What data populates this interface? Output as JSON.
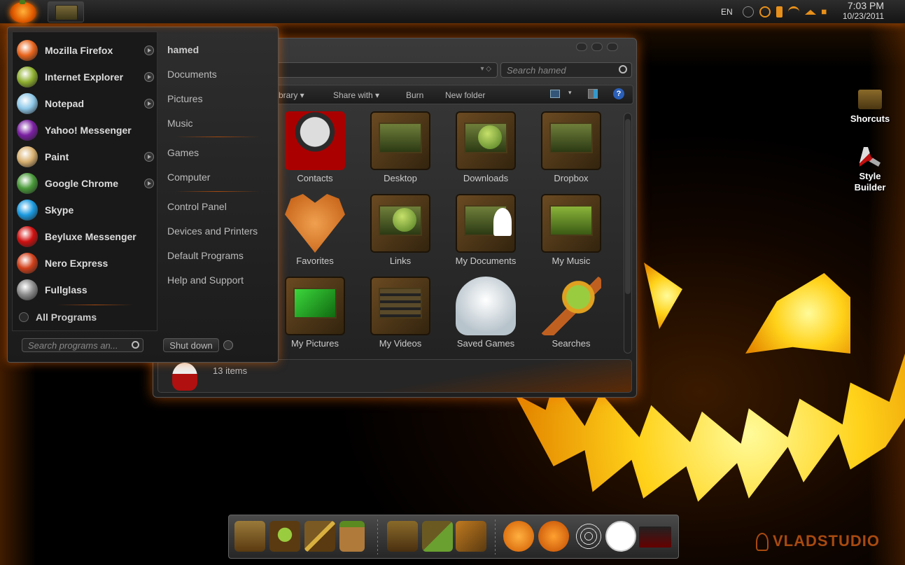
{
  "taskbar": {
    "language": "EN",
    "time": "7:03 PM",
    "date": "10/23/2011"
  },
  "start_menu": {
    "programs": [
      {
        "label": "Mozilla Firefox",
        "icon": "firefox-icon",
        "color": "#e8641c",
        "has_arrow": true
      },
      {
        "label": "Internet Explorer",
        "icon": "internet-explorer-icon",
        "color": "#8fb030",
        "has_arrow": true
      },
      {
        "label": "Notepad",
        "icon": "notepad-icon",
        "color": "#8ec8e8",
        "has_arrow": true
      },
      {
        "label": "Yahoo! Messenger",
        "icon": "yahoo-messenger-icon",
        "color": "#7a1fa2",
        "has_arrow": false
      },
      {
        "label": "Paint",
        "icon": "paint-icon",
        "color": "#d8b070",
        "has_arrow": true
      },
      {
        "label": "Google Chrome",
        "icon": "chrome-icon",
        "color": "#4a9a3a",
        "has_arrow": true
      },
      {
        "label": "Skype",
        "icon": "skype-icon",
        "color": "#1a9ae0",
        "has_arrow": false
      },
      {
        "label": "Beyluxe Messenger",
        "icon": "beyluxe-messenger-icon",
        "color": "#d01010",
        "has_arrow": false
      },
      {
        "label": "Nero Express",
        "icon": "nero-express-icon",
        "color": "#d0401a",
        "has_arrow": false
      },
      {
        "label": "Fullglass",
        "icon": "fullglass-icon",
        "color": "#8a8a8a",
        "has_arrow": false
      }
    ],
    "all_programs": "All Programs",
    "places": [
      "hamed",
      "Documents",
      "Pictures",
      "Music",
      "Games",
      "Computer",
      "Control Panel",
      "Devices and Printers",
      "Default Programs",
      "Help and Support"
    ],
    "search_placeholder": "Search programs an...",
    "shutdown_label": "Shut down"
  },
  "explorer": {
    "search_placeholder": "Search hamed",
    "commands": [
      "brary",
      "Share with",
      "Burn",
      "New folder"
    ],
    "items": [
      "Contacts",
      "Desktop",
      "Downloads",
      "Dropbox",
      "Favorites",
      "Links",
      "My Documents",
      "My Music",
      "My Pictures",
      "My Videos",
      "Saved Games",
      "Searches"
    ],
    "status": "13 items"
  },
  "desktop_icons": [
    {
      "label": "Shorcuts",
      "icon": "folder-icon"
    },
    {
      "label": "Style Builder",
      "icon": "style-builder-icon"
    }
  ],
  "watermark": "VLADSTUDIO",
  "dock": [
    "folder-icon",
    "globe-folder-icon",
    "tools-folder-icon",
    "bag-icon",
    "house-icon",
    "notepad-folder-icon",
    "settings-icon",
    "pumpkin-icon",
    "pumpkin-icon",
    "spiderweb-icon",
    "clock-icon",
    "screen-icon"
  ]
}
